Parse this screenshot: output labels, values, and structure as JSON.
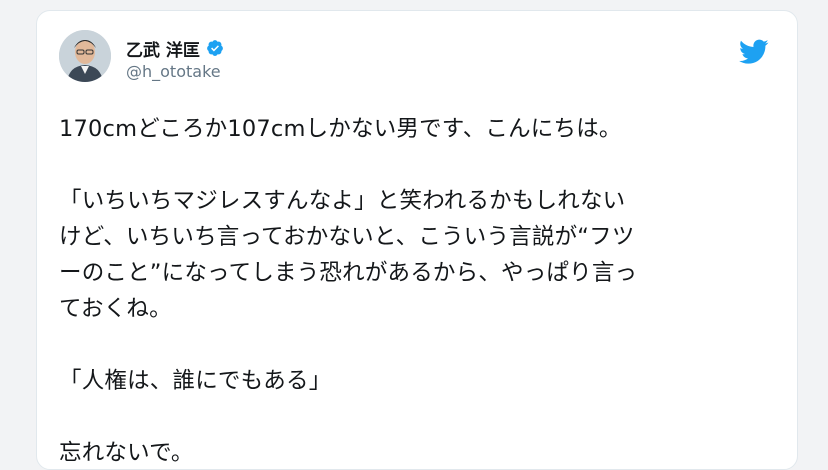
{
  "tweet": {
    "author": {
      "display_name": "乙武 洋匡",
      "handle": "@h_ototake",
      "verified": true
    },
    "logo": "twitter-bird-icon",
    "colors": {
      "accent": "#1da1f2",
      "text": "#14171a",
      "secondary": "#657786"
    },
    "paragraphs": [
      {
        "lines": [
          "170cmどころか107cmしかない男です、こんにちは。"
        ]
      },
      {
        "lines": [
          "「いちいちマジレスすんなよ」と笑われるかもしれない",
          "けど、いちいち言っておかないと、こういう言説が“フツ",
          "ーのこと”になってしまう恐れがあるから、やっぱり言っ",
          "ておくね。"
        ]
      },
      {
        "lines": [
          "「人権は、誰にでもある」"
        ]
      },
      {
        "lines": [
          "忘れないで。"
        ]
      }
    ]
  }
}
